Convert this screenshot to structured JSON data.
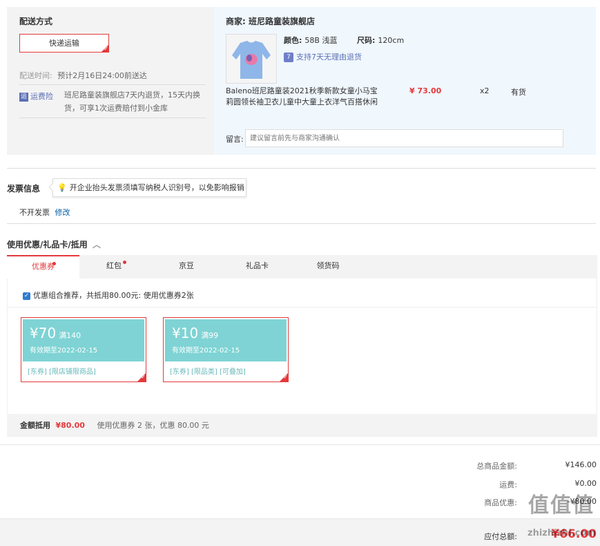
{
  "shipping": {
    "title": "配送方式",
    "method_button": "快递运输",
    "time_label": "配送时间:",
    "time_value": "预计2月16日24:00前送达",
    "insurance_icon": "运",
    "insurance_label": "运费险",
    "insurance_desc": "班尼路童装旗舰店7天内退货，15天内换货，可享1次运费赔付到小金库"
  },
  "merchant": {
    "label": "商家:",
    "name": "班尼路童装旗舰店"
  },
  "product": {
    "color_label": "颜色:",
    "color_value": "58B 浅蓝",
    "size_label": "尺码:",
    "size_value": "120cm",
    "return_icon": "7",
    "return_tag": "支持7天无理由退货",
    "name": "Baleno班尼路童装2021秋季新款女童小马宝莉圆领长袖卫衣儿童中大童上衣洋气百搭休闲",
    "price": "¥ 73.00",
    "quantity": "x2",
    "stock": "有货",
    "image_icon": "sweatshirt-image"
  },
  "note": {
    "label": "留言:",
    "placeholder": "建议留言前先与商家沟通确认"
  },
  "invoice": {
    "title": "发票信息",
    "tip": "开企业抬头发票须填写纳税人识别号，以免影响报销",
    "status": "不开发票",
    "edit_link": "修改"
  },
  "coupons": {
    "title": "使用优惠/礼品卡/抵用",
    "tabs": [
      {
        "label": "优惠券",
        "dot": true
      },
      {
        "label": "红包",
        "dot": true
      },
      {
        "label": "京豆",
        "dot": false
      },
      {
        "label": "礼品卡",
        "dot": false
      },
      {
        "label": "领货码",
        "dot": false
      }
    ],
    "combo_check": "优惠组合推荐，共抵用80.00元: 使用优惠券2张",
    "items": [
      {
        "amount": "¥70",
        "min": "满140",
        "expiry": "有效期至2022-02-15",
        "tags": "[东券] [限店铺限商品]"
      },
      {
        "amount": "¥10",
        "min": "满99",
        "expiry": "有效期至2022-02-15",
        "tags": "[东券] [限品类] [可叠加]"
      }
    ],
    "deduct_label": "金额抵用",
    "deduct_value": "¥80.00",
    "deduct_desc": "使用优惠券 2 张，优惠 80.00 元"
  },
  "totals": {
    "goods_label": "总商品金额:",
    "goods_value": "¥146.00",
    "freight_label": "运费:",
    "freight_value": "¥0.00",
    "discount_label": "商品优惠:",
    "discount_value": "-¥80.00",
    "payable_label": "应付总额:",
    "payable_value": "¥66.00"
  },
  "watermark": {
    "main": "值值值",
    "sub": "zhizhizhi.com"
  },
  "colors": {
    "accent_red": "#e4393c",
    "coupon_teal": "#7fd3d4",
    "link_blue": "#005ea7"
  }
}
